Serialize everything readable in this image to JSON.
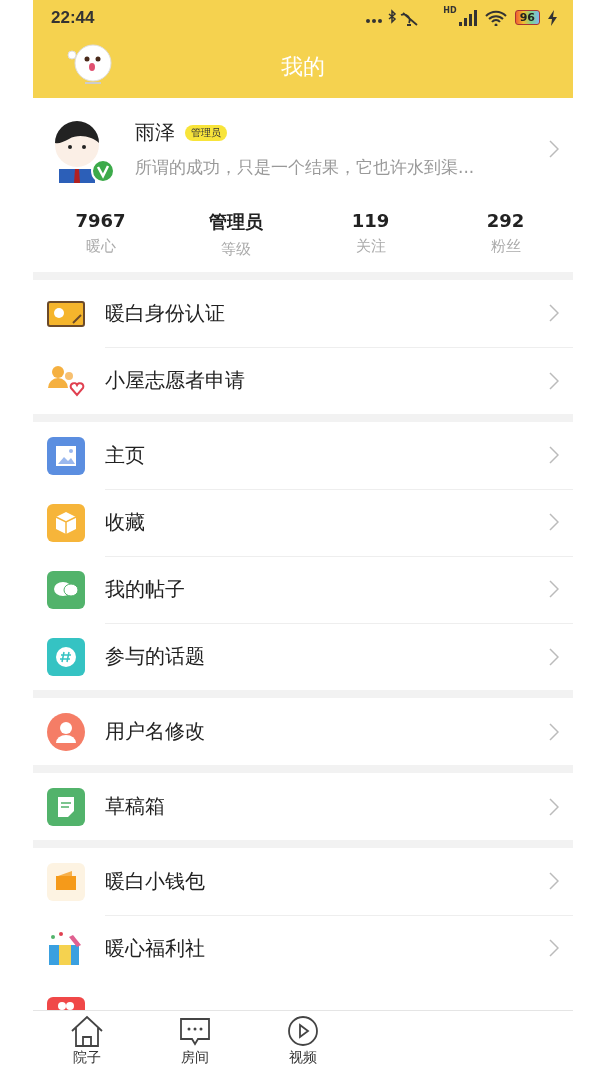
{
  "status_bar": {
    "time": "22:44",
    "network": "HD",
    "battery": "96"
  },
  "header": {
    "title": "我的"
  },
  "profile": {
    "name": "雨泽",
    "badge": "管理员",
    "bio": "所谓的成功，只是一个结果，它也许水到渠...",
    "verified": true
  },
  "stats": [
    {
      "value": "7967",
      "label": "暖心"
    },
    {
      "value": "管理员",
      "label": "等级"
    },
    {
      "value": "119",
      "label": "关注"
    },
    {
      "value": "292",
      "label": "粉丝"
    }
  ],
  "menu_groups": [
    [
      {
        "label": "暖白身份认证"
      },
      {
        "label": "小屋志愿者申请"
      }
    ],
    [
      {
        "label": "主页"
      },
      {
        "label": "收藏"
      },
      {
        "label": "我的帖子"
      },
      {
        "label": "参与的话题"
      }
    ],
    [
      {
        "label": "用户名修改"
      }
    ],
    [
      {
        "label": "草稿箱"
      }
    ],
    [
      {
        "label": "暖白小钱包"
      },
      {
        "label": "暖心福利社"
      }
    ]
  ],
  "tab_bar": [
    {
      "label": "院子"
    },
    {
      "label": "房间"
    },
    {
      "label": "视频"
    }
  ]
}
